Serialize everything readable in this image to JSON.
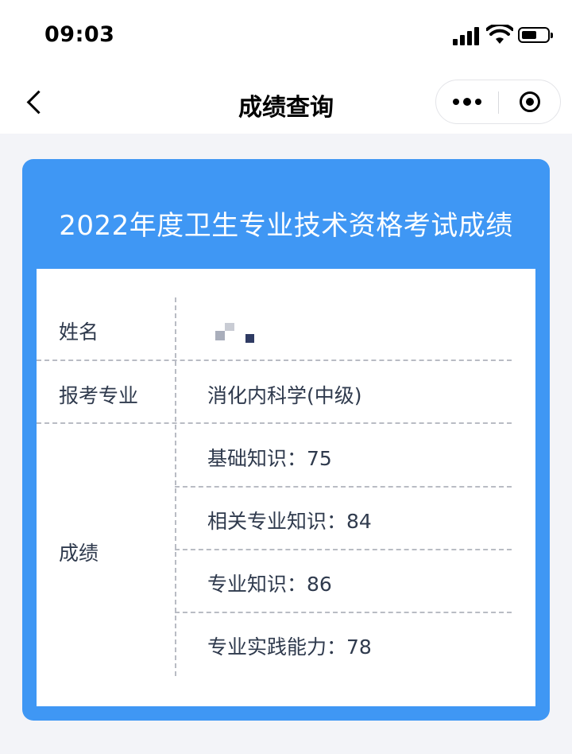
{
  "status_bar": {
    "time": "09:03"
  },
  "nav": {
    "title": "成绩查询"
  },
  "card": {
    "title": "2022年度卫生专业技术资格考试成绩",
    "name_label": "姓名",
    "major_label": "报考专业",
    "major_value": "消化内科学(中级)",
    "score_label": "成绩",
    "scores": [
      "基础知识：75",
      "相关专业知识：84",
      "专业知识：86",
      "专业实践能力：78"
    ]
  },
  "colors": {
    "accent": "#3f97f4",
    "page_background": "#f3f4f8",
    "text": "#2f3a4d"
  }
}
